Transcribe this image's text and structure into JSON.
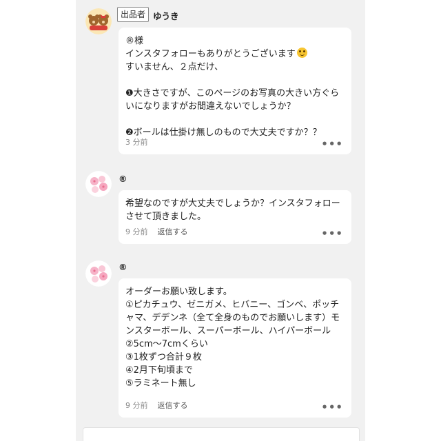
{
  "comments": [
    {
      "badge": "出品者",
      "user": "ゆうき",
      "lines": [
        "®様",
        "インスタフォローもありがとうございます",
        "すいません、２点だけ、",
        "",
        "❶大きさですが、このページのお写真の大きい方ぐらいになりますがお間違えないでしょうか？",
        "",
        "❷ボールは仕掛け無しのもので大丈夫ですか？？"
      ],
      "time": "3 分前"
    },
    {
      "user": "®",
      "lines": [
        "希望なのですが大丈夫でしょうか？インスタフォローさせて頂きました。"
      ],
      "time": "9 分前",
      "reply": "返信する"
    },
    {
      "user": "®",
      "lines": [
        "オーダーお願い致します。",
        "①ピカチュウ、ゼニガメ、ヒバニー、ゴンベ、ポッチャマ、デデンネ（全て全身のものでお願いします）モンスターボール、スーパーボール、ハイパーボール",
        "②5cm〜7cmくらい",
        "③1枚ずつ合計９枚",
        "④2月下旬頃まで",
        "⑤ラミネート無し"
      ],
      "time": "9 分前",
      "reply": "返信する"
    }
  ],
  "more_icon": "ellipsis-icon",
  "colors": {
    "background": "#f1f1f1",
    "bubble": "#ffffff",
    "meta": "#8a8a8a"
  }
}
